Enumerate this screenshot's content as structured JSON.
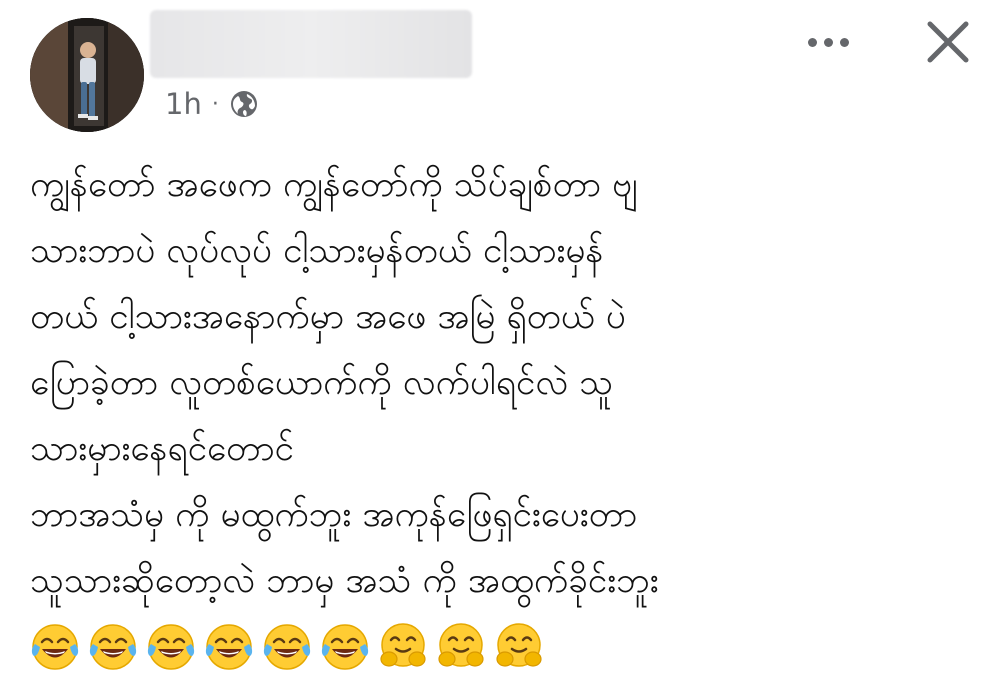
{
  "post": {
    "timestamp": "1h",
    "separator": "·",
    "privacy_icon": "globe-icon",
    "more_icon": "more-options-icon",
    "close_icon": "close-icon",
    "lines": [
      "ကျွန်တော် အဖေက ကျွန်တော်ကို သိပ်ချစ်တာ ဗျ",
      "သားဘာပဲ လုပ်လုပ် ငါ့သားမှန်တယ် ငါ့သားမှန်",
      "တယ် ငါ့သားအနောက်မှာ အဖေ အမြဲ ရှိတယ် ပဲ",
      "ပြောခဲ့တာ လူတစ်ယောက်ကို လက်ပါရင်လဲ သူ",
      "သားမှားနေရင်တောင်",
      "ဘာအသံမှ ကို မထွက်ဘူး အကုန်ဖြေရှင်းပေးတာ",
      "သူသားဆိုတော့လဲ ဘာမှ အသံ ကို အထွက်ခိုင်းဘူး"
    ],
    "emojis": [
      "face-with-tears-of-joy",
      "face-with-tears-of-joy",
      "face-with-tears-of-joy",
      "face-with-tears-of-joy",
      "face-with-tears-of-joy",
      "face-with-tears-of-joy",
      "hugging-face",
      "hugging-face",
      "hugging-face"
    ]
  },
  "colors": {
    "meta_text": "#65676b",
    "body_text": "#111111",
    "background": "#ffffff"
  }
}
